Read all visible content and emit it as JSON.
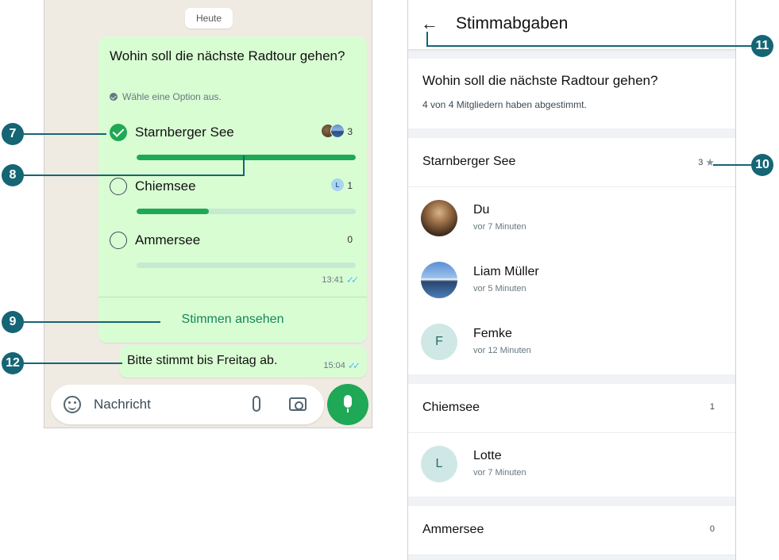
{
  "chat": {
    "date_chip": "Heute",
    "poll": {
      "question": "Wohin soll die nächste Radtour gehen?",
      "hint": "Wähle eine Option aus.",
      "options": [
        {
          "label": "Starnberger See",
          "count": "3",
          "fill": 1.0,
          "selected": true
        },
        {
          "label": "Chiemsee",
          "count": "1",
          "fill": 0.33,
          "selected": false,
          "avatar_letter": "L"
        },
        {
          "label": "Ammersee",
          "count": "0",
          "fill": 0.0,
          "selected": false
        }
      ],
      "time": "13:41",
      "view_votes": "Stimmen ansehen"
    },
    "message": {
      "text": "Bitte stimmt bis Freitag ab.",
      "time": "15:04"
    },
    "input": {
      "placeholder": "Nachricht"
    },
    "colors": {
      "accent": "#1fa855",
      "bubble": "#d9fdd3",
      "background": "#efeae2"
    }
  },
  "votes": {
    "title": "Stimmabgaben",
    "question": "Wohin soll die nächste Radtour gehen?",
    "summary": "4 von 4 Mitgliedern haben abgestimmt.",
    "groups": [
      {
        "label": "Starnberger See",
        "count": "3",
        "voters": [
          {
            "name": "Du",
            "time": "vor 7 Minuten"
          },
          {
            "name": "Liam Müller",
            "time": "vor 5 Minuten"
          },
          {
            "name": "Femke",
            "time": "vor 12 Minuten",
            "letter": "F"
          }
        ]
      },
      {
        "label": "Chiemsee",
        "count": "1",
        "voters": [
          {
            "name": "Lotte",
            "time": "vor 7 Minuten",
            "letter": "L"
          }
        ]
      },
      {
        "label": "Ammersee",
        "count": "0",
        "voters": []
      }
    ]
  },
  "callouts": {
    "c7": "7",
    "c8": "8",
    "c9": "9",
    "c10": "10",
    "c11": "11",
    "c12": "12",
    "color": "#156575"
  },
  "icons": [
    "check-icon",
    "emoji-icon",
    "paperclip-icon",
    "camera-icon",
    "mic-icon",
    "back-arrow-icon",
    "star-icon",
    "double-tick-icon"
  ]
}
